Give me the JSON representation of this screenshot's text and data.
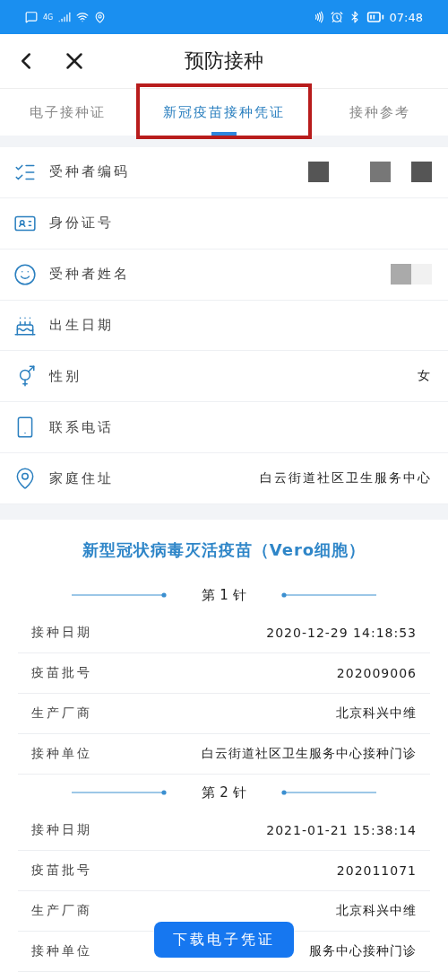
{
  "status_bar": {
    "network": "4G",
    "time": "07:48"
  },
  "header": {
    "title": "预防接种"
  },
  "tabs": [
    {
      "label": "电子接种证",
      "selected": false,
      "highlighted": false
    },
    {
      "label": "新冠疫苗接种凭证",
      "selected": true,
      "highlighted": true
    },
    {
      "label": "接种参考",
      "selected": false,
      "highlighted": false
    }
  ],
  "profile": [
    {
      "label": "受种者编码",
      "redacted": true
    },
    {
      "label": "身份证号"
    },
    {
      "label": "受种者姓名",
      "redacted": true
    },
    {
      "label": "出生日期"
    },
    {
      "label": "性别",
      "value": "女"
    },
    {
      "label": "联系电话"
    },
    {
      "label": "家庭住址",
      "value": "白云街道社区卫生服务中心"
    }
  ],
  "vaccine": {
    "title": "新型冠状病毒灭活疫苗（Vero细胞）",
    "doses": [
      {
        "heading": "第 1 针",
        "rows": [
          {
            "label": "接种日期",
            "value": "2020-12-29 14:18:53"
          },
          {
            "label": "疫苗批号",
            "value": "202009006"
          },
          {
            "label": "生产厂商",
            "value": "北京科兴中维"
          },
          {
            "label": "接种单位",
            "value": "白云街道社区卫生服务中心接种门诊"
          }
        ]
      },
      {
        "heading": "第 2 针",
        "rows": [
          {
            "label": "接种日期",
            "value": "2021-01-21 15:38:14"
          },
          {
            "label": "疫苗批号",
            "value": "202011071"
          },
          {
            "label": "生产厂商",
            "value": "北京科兴中维"
          },
          {
            "label": "接种单位",
            "value": "服务中心接种门诊"
          }
        ]
      }
    ]
  },
  "download_button": {
    "label": "下载电子凭证"
  }
}
